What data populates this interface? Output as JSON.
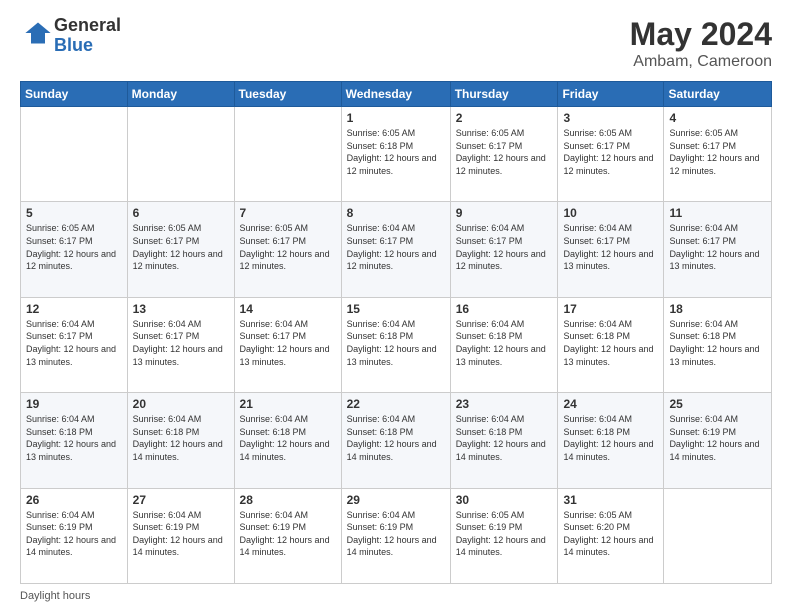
{
  "header": {
    "logo_line1": "General",
    "logo_line2": "Blue",
    "month_title": "May 2024",
    "location": "Ambam, Cameroon"
  },
  "days_of_week": [
    "Sunday",
    "Monday",
    "Tuesday",
    "Wednesday",
    "Thursday",
    "Friday",
    "Saturday"
  ],
  "weeks": [
    [
      {
        "day": "",
        "info": ""
      },
      {
        "day": "",
        "info": ""
      },
      {
        "day": "",
        "info": ""
      },
      {
        "day": "1",
        "info": "Sunrise: 6:05 AM\nSunset: 6:18 PM\nDaylight: 12 hours\nand 12 minutes."
      },
      {
        "day": "2",
        "info": "Sunrise: 6:05 AM\nSunset: 6:17 PM\nDaylight: 12 hours\nand 12 minutes."
      },
      {
        "day": "3",
        "info": "Sunrise: 6:05 AM\nSunset: 6:17 PM\nDaylight: 12 hours\nand 12 minutes."
      },
      {
        "day": "4",
        "info": "Sunrise: 6:05 AM\nSunset: 6:17 PM\nDaylight: 12 hours\nand 12 minutes."
      }
    ],
    [
      {
        "day": "5",
        "info": "Sunrise: 6:05 AM\nSunset: 6:17 PM\nDaylight: 12 hours\nand 12 minutes."
      },
      {
        "day": "6",
        "info": "Sunrise: 6:05 AM\nSunset: 6:17 PM\nDaylight: 12 hours\nand 12 minutes."
      },
      {
        "day": "7",
        "info": "Sunrise: 6:05 AM\nSunset: 6:17 PM\nDaylight: 12 hours\nand 12 minutes."
      },
      {
        "day": "8",
        "info": "Sunrise: 6:04 AM\nSunset: 6:17 PM\nDaylight: 12 hours\nand 12 minutes."
      },
      {
        "day": "9",
        "info": "Sunrise: 6:04 AM\nSunset: 6:17 PM\nDaylight: 12 hours\nand 12 minutes."
      },
      {
        "day": "10",
        "info": "Sunrise: 6:04 AM\nSunset: 6:17 PM\nDaylight: 12 hours\nand 13 minutes."
      },
      {
        "day": "11",
        "info": "Sunrise: 6:04 AM\nSunset: 6:17 PM\nDaylight: 12 hours\nand 13 minutes."
      }
    ],
    [
      {
        "day": "12",
        "info": "Sunrise: 6:04 AM\nSunset: 6:17 PM\nDaylight: 12 hours\nand 13 minutes."
      },
      {
        "day": "13",
        "info": "Sunrise: 6:04 AM\nSunset: 6:17 PM\nDaylight: 12 hours\nand 13 minutes."
      },
      {
        "day": "14",
        "info": "Sunrise: 6:04 AM\nSunset: 6:17 PM\nDaylight: 12 hours\nand 13 minutes."
      },
      {
        "day": "15",
        "info": "Sunrise: 6:04 AM\nSunset: 6:18 PM\nDaylight: 12 hours\nand 13 minutes."
      },
      {
        "day": "16",
        "info": "Sunrise: 6:04 AM\nSunset: 6:18 PM\nDaylight: 12 hours\nand 13 minutes."
      },
      {
        "day": "17",
        "info": "Sunrise: 6:04 AM\nSunset: 6:18 PM\nDaylight: 12 hours\nand 13 minutes."
      },
      {
        "day": "18",
        "info": "Sunrise: 6:04 AM\nSunset: 6:18 PM\nDaylight: 12 hours\nand 13 minutes."
      }
    ],
    [
      {
        "day": "19",
        "info": "Sunrise: 6:04 AM\nSunset: 6:18 PM\nDaylight: 12 hours\nand 13 minutes."
      },
      {
        "day": "20",
        "info": "Sunrise: 6:04 AM\nSunset: 6:18 PM\nDaylight: 12 hours\nand 14 minutes."
      },
      {
        "day": "21",
        "info": "Sunrise: 6:04 AM\nSunset: 6:18 PM\nDaylight: 12 hours\nand 14 minutes."
      },
      {
        "day": "22",
        "info": "Sunrise: 6:04 AM\nSunset: 6:18 PM\nDaylight: 12 hours\nand 14 minutes."
      },
      {
        "day": "23",
        "info": "Sunrise: 6:04 AM\nSunset: 6:18 PM\nDaylight: 12 hours\nand 14 minutes."
      },
      {
        "day": "24",
        "info": "Sunrise: 6:04 AM\nSunset: 6:18 PM\nDaylight: 12 hours\nand 14 minutes."
      },
      {
        "day": "25",
        "info": "Sunrise: 6:04 AM\nSunset: 6:19 PM\nDaylight: 12 hours\nand 14 minutes."
      }
    ],
    [
      {
        "day": "26",
        "info": "Sunrise: 6:04 AM\nSunset: 6:19 PM\nDaylight: 12 hours\nand 14 minutes."
      },
      {
        "day": "27",
        "info": "Sunrise: 6:04 AM\nSunset: 6:19 PM\nDaylight: 12 hours\nand 14 minutes."
      },
      {
        "day": "28",
        "info": "Sunrise: 6:04 AM\nSunset: 6:19 PM\nDaylight: 12 hours\nand 14 minutes."
      },
      {
        "day": "29",
        "info": "Sunrise: 6:04 AM\nSunset: 6:19 PM\nDaylight: 12 hours\nand 14 minutes."
      },
      {
        "day": "30",
        "info": "Sunrise: 6:05 AM\nSunset: 6:19 PM\nDaylight: 12 hours\nand 14 minutes."
      },
      {
        "day": "31",
        "info": "Sunrise: 6:05 AM\nSunset: 6:20 PM\nDaylight: 12 hours\nand 14 minutes."
      },
      {
        "day": "",
        "info": ""
      }
    ]
  ],
  "footer": {
    "note": "Daylight hours"
  }
}
